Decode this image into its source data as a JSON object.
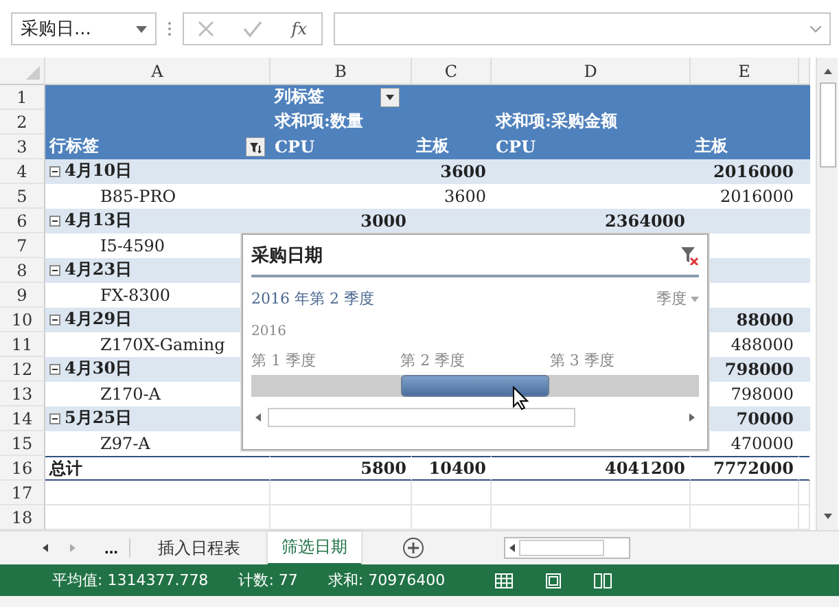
{
  "name_box": "采购日...",
  "formula_fx": "fx",
  "columns": [
    "A",
    "B",
    "C",
    "D",
    "E"
  ],
  "rows": [
    {
      "num": "1",
      "kind": "header",
      "cells": [
        "",
        "列标签",
        "",
        "",
        ""
      ]
    },
    {
      "num": "2",
      "kind": "header",
      "cells": [
        "",
        "求和项:数量",
        "",
        "求和项:采购金额",
        ""
      ]
    },
    {
      "num": "3",
      "kind": "header",
      "cells": [
        "行标签",
        "CPU",
        "主板",
        "CPU",
        "主板"
      ]
    },
    {
      "num": "4",
      "kind": "group",
      "cells": [
        "4月10日",
        "",
        "3600",
        "",
        "2016000"
      ]
    },
    {
      "num": "5",
      "kind": "item",
      "cells": [
        "B85-PRO",
        "",
        "3600",
        "",
        "2016000"
      ]
    },
    {
      "num": "6",
      "kind": "group",
      "cells": [
        "4月13日",
        "3000",
        "",
        "2364000",
        ""
      ]
    },
    {
      "num": "7",
      "kind": "item",
      "cells": [
        "I5-4590",
        "",
        "",
        "",
        ""
      ]
    },
    {
      "num": "8",
      "kind": "group",
      "cells": [
        "4月23日",
        "",
        "",
        "",
        ""
      ]
    },
    {
      "num": "9",
      "kind": "item",
      "cells": [
        "FX-8300",
        "",
        "",
        "",
        ""
      ]
    },
    {
      "num": "10",
      "kind": "group",
      "cells": [
        "4月29日",
        "",
        "",
        "",
        "88000"
      ]
    },
    {
      "num": "11",
      "kind": "item",
      "cells": [
        "Z170X-Gaming",
        "",
        "",
        "",
        "488000"
      ]
    },
    {
      "num": "12",
      "kind": "group",
      "cells": [
        "4月30日",
        "",
        "",
        "",
        "798000"
      ]
    },
    {
      "num": "13",
      "kind": "item",
      "cells": [
        "Z170-A",
        "",
        "",
        "",
        "798000"
      ]
    },
    {
      "num": "14",
      "kind": "group",
      "cells": [
        "5月25日",
        "",
        "",
        "",
        "70000"
      ]
    },
    {
      "num": "15",
      "kind": "item",
      "cells": [
        "Z97-A",
        "",
        "",
        "",
        "470000"
      ]
    },
    {
      "num": "16",
      "kind": "total",
      "cells": [
        "总计",
        "5800",
        "10400",
        "4041200",
        "7772000"
      ]
    },
    {
      "num": "17",
      "kind": "empty",
      "cells": [
        "",
        "",
        "",
        "",
        ""
      ]
    },
    {
      "num": "18",
      "kind": "empty",
      "cells": [
        "",
        "",
        "",
        "",
        ""
      ]
    }
  ],
  "slicer": {
    "title": "采购日期",
    "selection": "2016 年第 2 季度",
    "level_menu": "季度",
    "year": "2016",
    "quarters": [
      {
        "label": "第 1 季度",
        "selected": false
      },
      {
        "label": "第 2 季度",
        "selected": true
      },
      {
        "label": "第 3 季度",
        "selected": false
      }
    ]
  },
  "sheet_tabs": [
    {
      "label": "插入日程表",
      "selected": false
    },
    {
      "label": "筛选日期",
      "selected": true
    }
  ],
  "sheet_nav_more": "...",
  "status_bar": [
    "平均值: 1314377.778",
    "计数: 77",
    "求和: 70976400"
  ]
}
